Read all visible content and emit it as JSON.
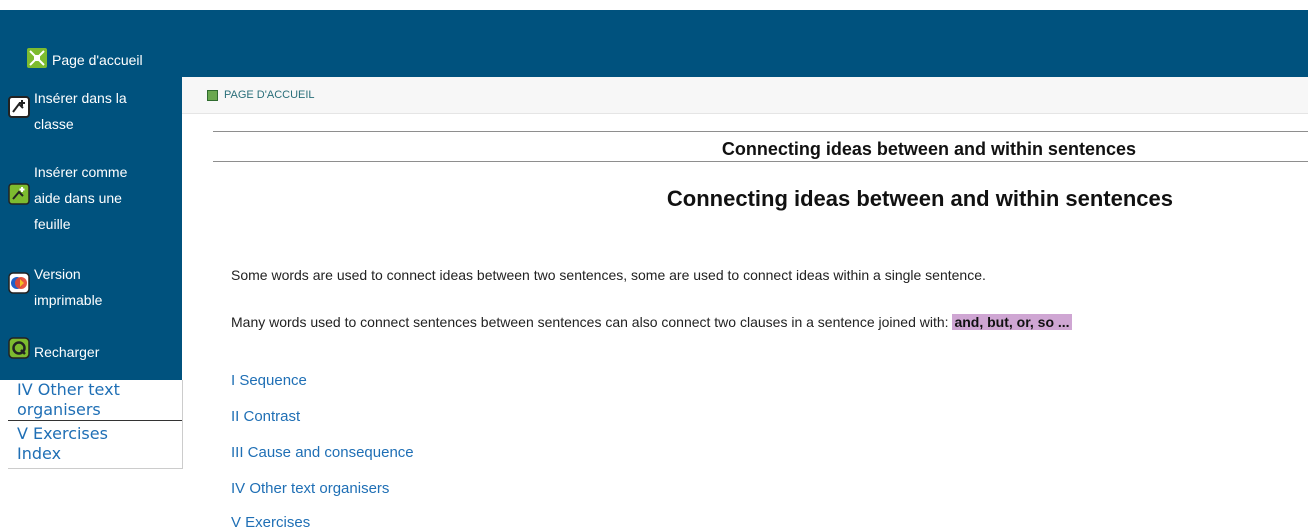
{
  "header": {
    "home_label": "Page d'accueil"
  },
  "sidebar": {
    "items": [
      {
        "label_line1": "Insérer dans la",
        "label_line2": "classe"
      },
      {
        "label_line1": "Insérer comme",
        "label_line2": "aide dans une",
        "label_line3": "feuille"
      },
      {
        "label_line1": "Version",
        "label_line2": "imprimable"
      },
      {
        "label_line1": "Recharger"
      }
    ],
    "links": [
      "IV Other text",
      "organisers",
      "V Exercises",
      "Index"
    ]
  },
  "breadcrumb": {
    "label": "PAGE D'ACCUEIL"
  },
  "main": {
    "subtitle": "Connecting ideas between and within sentences",
    "title": "Connecting ideas between and within sentences",
    "paragraph1": "Some words are used to connect ideas between two sentences, some are used to connect ideas within a single sentence.",
    "paragraph2": "Many words used to connect sentences between sentences can also connect two clauses in a sentence joined with: ",
    "highlight": "and, but, or, so ...",
    "toc": [
      "I Sequence",
      "II Contrast",
      "III Cause and consequence",
      "IV Other text organisers",
      "V Exercises"
    ]
  },
  "colors": {
    "header_bg": "#00527e",
    "link": "#1f6fb5",
    "highlight": "#cfa6d3"
  }
}
